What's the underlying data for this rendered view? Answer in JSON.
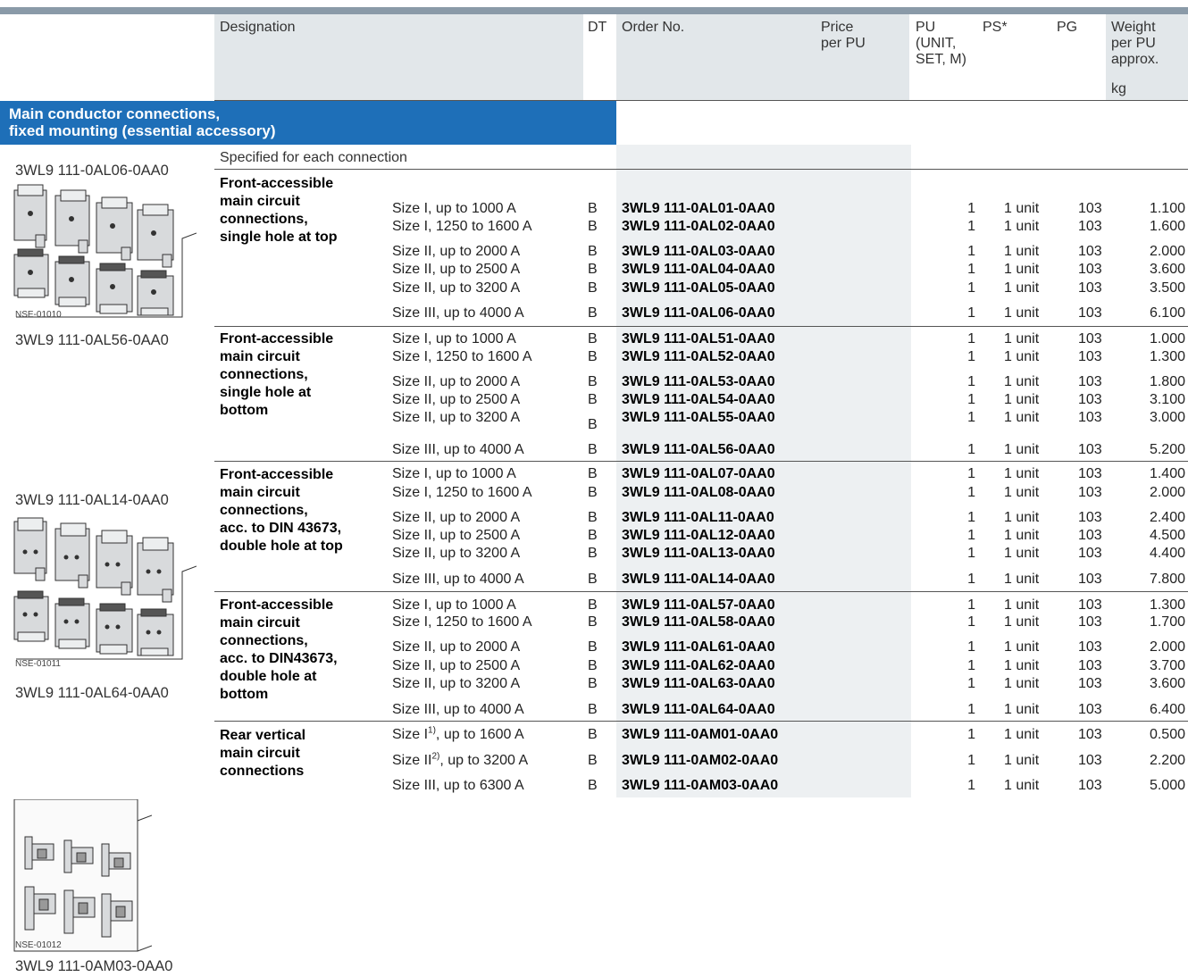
{
  "header": {
    "designation": "Designation",
    "dt": "DT",
    "order_no": "Order No.",
    "price": "Price\nper PU",
    "pu": "PU\n(UNIT,\nSET, M)",
    "ps": "PS*",
    "pg": "PG",
    "weight": "Weight\nper PU\napprox.",
    "weight_unit": "kg"
  },
  "section": {
    "title": "Main conductor connections,\nfixed mounting (essential accessory)"
  },
  "specified_note": "Specified for each connection",
  "image_labels": {
    "img1_top": "3WL9 111-0AL06-0AA0",
    "img1_code": "NSE-01010",
    "img1_bottom": "3WL9 111-0AL56-0AA0",
    "img2_top": "3WL9 111-0AL14-0AA0",
    "img2_code": "NSE-01011",
    "img2_bottom": "3WL9 111-0AL64-0AA0",
    "img3_code": "NSE-01012",
    "img3_bottom": "3WL9 111-0AM03-0AA0"
  },
  "groups": [
    "Front-accessible\nmain circuit\nconnections,\nsingle hole at top",
    "Front-accessible\nmain circuit\nconnections,\nsingle hole at\nbottom",
    "Front-accessible\nmain circuit\nconnections,\nacc. to DIN 43673,\ndouble hole at top",
    "Front-accessible\nmain circuit\nconnections,\nacc. to DIN43673,\ndouble hole at\nbottom",
    "Rear vertical\nmain circuit\nconnections"
  ],
  "rows": [
    {
      "desc": "Size I, up to 1000 A",
      "dt": "B",
      "order": "3WL9 111-0AL01-0AA0",
      "pu": "1",
      "ps": "1 unit",
      "pg": "103",
      "weight": "1.100"
    },
    {
      "desc": "Size I, 1250 to 1600 A",
      "dt": "B",
      "order": "3WL9 111-0AL02-0AA0",
      "pu": "1",
      "ps": "1 unit",
      "pg": "103",
      "weight": "1.600"
    },
    {
      "desc": "Size II, up to 2000 A",
      "dt": "B",
      "order": "3WL9 111-0AL03-0AA0",
      "pu": "1",
      "ps": "1 unit",
      "pg": "103",
      "weight": "2.000"
    },
    {
      "desc": "Size II, up to 2500 A",
      "dt": "B",
      "order": "3WL9 111-0AL04-0AA0",
      "pu": "1",
      "ps": "1 unit",
      "pg": "103",
      "weight": "3.600"
    },
    {
      "desc": "Size II, up to 3200 A",
      "dt": "B",
      "order": "3WL9 111-0AL05-0AA0",
      "pu": "1",
      "ps": "1 unit",
      "pg": "103",
      "weight": "3.500"
    },
    {
      "desc": "Size III, up to 4000 A",
      "dt": "B",
      "order": "3WL9 111-0AL06-0AA0",
      "pu": "1",
      "ps": "1 unit",
      "pg": "103",
      "weight": "6.100"
    },
    {
      "desc": "Size I, up to 1000 A",
      "dt": "B",
      "order": "3WL9 111-0AL51-0AA0",
      "pu": "1",
      "ps": "1 unit",
      "pg": "103",
      "weight": "1.000"
    },
    {
      "desc": "Size I, 1250 to 1600 A",
      "dt": "B",
      "order": "3WL9 111-0AL52-0AA0",
      "pu": "1",
      "ps": "1 unit",
      "pg": "103",
      "weight": "1.300"
    },
    {
      "desc": "Size II, up to 2000 A",
      "dt": "B",
      "order": "3WL9 111-0AL53-0AA0",
      "pu": "1",
      "ps": "1 unit",
      "pg": "103",
      "weight": "1.800"
    },
    {
      "desc": "Size II, up to 2500 A",
      "dt": "B",
      "order": "3WL9 111-0AL54-0AA0",
      "pu": "1",
      "ps": "1 unit",
      "pg": "103",
      "weight": "3.100"
    },
    {
      "desc": "Size II, up to 3200 A",
      "dt": "B",
      "order": "3WL9 111-0AL55-0AA0",
      "pu": "1",
      "ps": "1 unit",
      "pg": "103",
      "weight": "3.000"
    },
    {
      "desc": "Size III, up to 4000 A",
      "dt": "B",
      "order": "3WL9 111-0AL56-0AA0",
      "pu": "1",
      "ps": "1 unit",
      "pg": "103",
      "weight": "5.200"
    },
    {
      "desc": "Size I, up to 1000 A",
      "dt": "B",
      "order": "3WL9 111-0AL07-0AA0",
      "pu": "1",
      "ps": "1 unit",
      "pg": "103",
      "weight": "1.400"
    },
    {
      "desc": "Size I, 1250 to 1600 A",
      "dt": "B",
      "order": "3WL9 111-0AL08-0AA0",
      "pu": "1",
      "ps": "1 unit",
      "pg": "103",
      "weight": "2.000"
    },
    {
      "desc": "Size II, up to 2000 A",
      "dt": "B",
      "order": "3WL9 111-0AL11-0AA0",
      "pu": "1",
      "ps": "1 unit",
      "pg": "103",
      "weight": "2.400"
    },
    {
      "desc": "Size II, up to 2500 A",
      "dt": "B",
      "order": "3WL9 111-0AL12-0AA0",
      "pu": "1",
      "ps": "1 unit",
      "pg": "103",
      "weight": "4.500"
    },
    {
      "desc": "Size II, up to 3200 A",
      "dt": "B",
      "order": "3WL9 111-0AL13-0AA0",
      "pu": "1",
      "ps": "1 unit",
      "pg": "103",
      "weight": "4.400"
    },
    {
      "desc": "Size III, up to 4000 A",
      "dt": "B",
      "order": "3WL9 111-0AL14-0AA0",
      "pu": "1",
      "ps": "1 unit",
      "pg": "103",
      "weight": "7.800"
    },
    {
      "desc": "Size I, up to 1000 A",
      "dt": "B",
      "order": "3WL9 111-0AL57-0AA0",
      "pu": "1",
      "ps": "1 unit",
      "pg": "103",
      "weight": "1.300"
    },
    {
      "desc": "Size I, 1250 to 1600 A",
      "dt": "B",
      "order": "3WL9 111-0AL58-0AA0",
      "pu": "1",
      "ps": "1 unit",
      "pg": "103",
      "weight": "1.700"
    },
    {
      "desc": "Size II, up to 2000 A",
      "dt": "B",
      "order": "3WL9 111-0AL61-0AA0",
      "pu": "1",
      "ps": "1 unit",
      "pg": "103",
      "weight": "2.000"
    },
    {
      "desc": "Size II, up to 2500 A",
      "dt": "B",
      "order": "3WL9 111-0AL62-0AA0",
      "pu": "1",
      "ps": "1 unit",
      "pg": "103",
      "weight": "3.700"
    },
    {
      "desc": "Size II, up to 3200 A",
      "dt": "B",
      "order": "3WL9 111-0AL63-0AA0",
      "pu": "1",
      "ps": "1 unit",
      "pg": "103",
      "weight": "3.600"
    },
    {
      "desc": "Size III, up to 4000 A",
      "dt": "B",
      "order": "3WL9 111-0AL64-0AA0",
      "pu": "1",
      "ps": "1 unit",
      "pg": "103",
      "weight": "6.400"
    },
    {
      "desc_pre": "Size I",
      "desc_sup": "1)",
      "desc_post": ", up to 1600 A",
      "dt": "B",
      "order": "3WL9 111-0AM01-0AA0",
      "pu": "1",
      "ps": "1 unit",
      "pg": "103",
      "weight": "0.500"
    },
    {
      "desc_pre": "Size II",
      "desc_sup": "2)",
      "desc_post": ", up to 3200 A",
      "dt": "B",
      "order": "3WL9 111-0AM02-0AA0",
      "pu": "1",
      "ps": "1 unit",
      "pg": "103",
      "weight": "2.200"
    },
    {
      "desc": "Size III, up to 6300 A",
      "dt": "B",
      "order": "3WL9 111-0AM03-0AA0",
      "pu": "1",
      "ps": "1 unit",
      "pg": "103",
      "weight": "5.000"
    }
  ]
}
